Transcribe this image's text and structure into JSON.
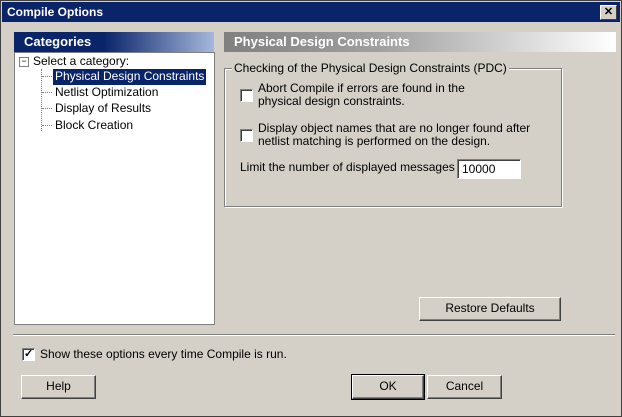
{
  "window": {
    "title": "Compile Options",
    "close_icon": "close-icon"
  },
  "categories": {
    "header": "Categories",
    "root_label": "Select a category:",
    "items": [
      {
        "label": "Physical Design Constraints",
        "selected": true
      },
      {
        "label": "Netlist Optimization",
        "selected": false
      },
      {
        "label": "Display of Results",
        "selected": false
      },
      {
        "label": "Block Creation",
        "selected": false
      }
    ]
  },
  "section": {
    "header": "Physical Design Constraints",
    "group_label": "Checking of the Physical Design Constraints (PDC)",
    "options": [
      {
        "label_line1": "Abort Compile if errors are found in the",
        "label_line2": "physical design constraints.",
        "checked": false
      },
      {
        "label_line1": "Display object names that are no longer found after",
        "label_line2": "netlist matching is performed on the design.",
        "checked": false
      }
    ],
    "limit_label": "Limit the number of displayed messages to:",
    "limit_value": "10000"
  },
  "buttons": {
    "restore_defaults": "Restore Defaults",
    "help": "Help",
    "ok": "OK",
    "cancel": "Cancel"
  },
  "footer": {
    "show_options_label": "Show these options every time Compile is run.",
    "show_options_checked": true
  }
}
